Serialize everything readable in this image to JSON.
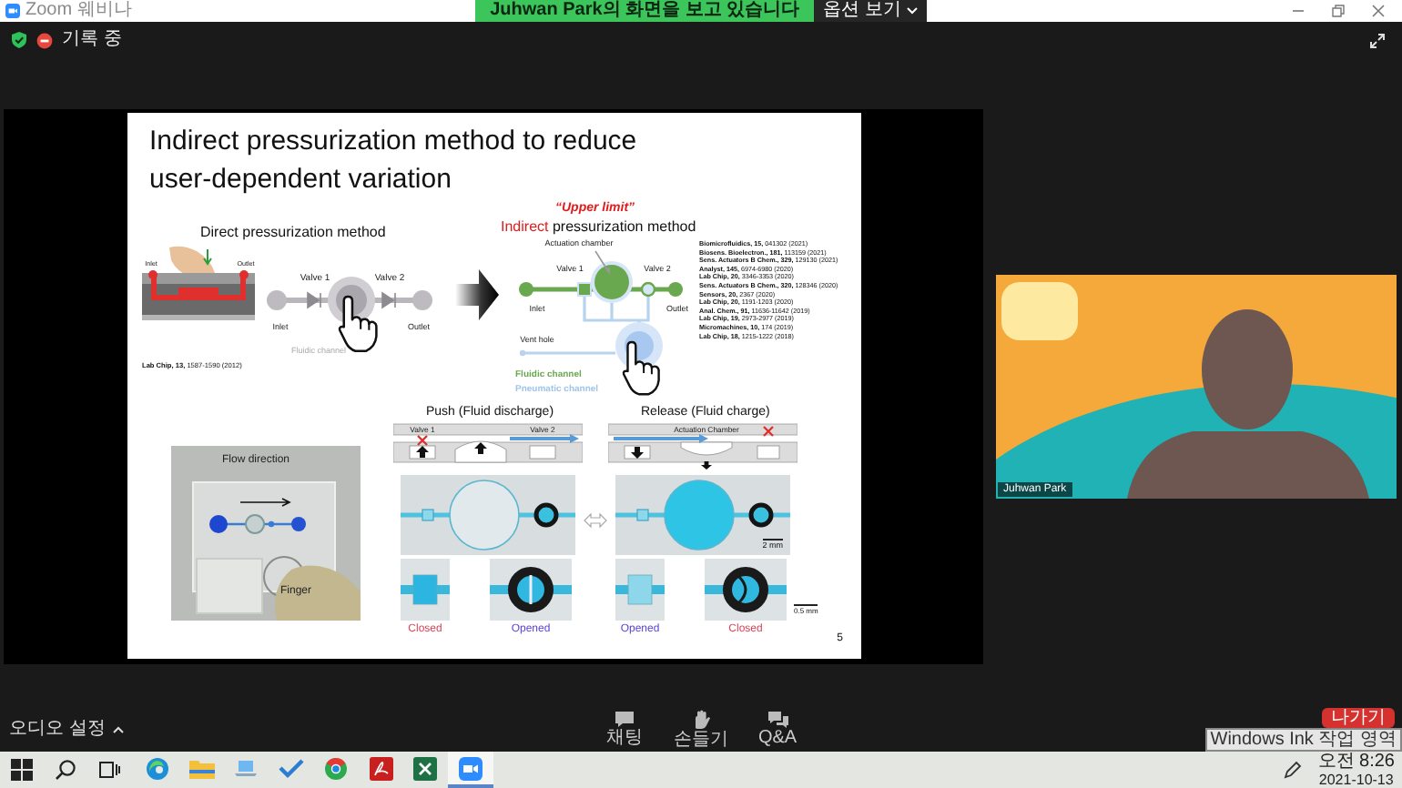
{
  "window": {
    "title": "Zoom 웨비나"
  },
  "share_banner": {
    "text": "Juhwan Park의 화면을 보고 있습니다",
    "options_button": "옵션 보기"
  },
  "status": {
    "recording": true,
    "recording_label": "기록 중"
  },
  "slide": {
    "title": "Indirect pressurization method to reduce user-dependent variation",
    "direct": {
      "heading": "Direct pressurization method",
      "chip_inlet": "Inlet",
      "chip_outlet": "Outlet",
      "valves": [
        "Valve 1",
        "Valve 2"
      ],
      "inlet": "Inlet",
      "outlet": "Outlet",
      "channel_label": "Fluidic channel",
      "citation": "**Lab Chip, 13,** 1587-1590 (2012)"
    },
    "indirect": {
      "note": "“Upper limit”",
      "heading": "**Indirect** pressurization method",
      "chamber_label": "Actuation chamber",
      "valves": [
        "Valve 1",
        "Valve 2"
      ],
      "inlet": "Inlet",
      "outlet": "Outlet",
      "vent_label": "Vent hole",
      "legend": [
        {
          "label": "Fluidic channel",
          "color": "#6aa84f"
        },
        {
          "label": "Pneumatic channel",
          "color": "#9fc5e8"
        }
      ],
      "references": [
        "**Biomicrofluidics, 15,** 041302 (2021)",
        "**Biosens. Bioelectron., 181,** 113159 (2021)",
        "**Sens. Actuators B Chem., 329,** 129130 (2021)",
        "**Analyst, 145,** 6974-6980 (2020)",
        "**Lab Chip, 20,** 3346-3353 (2020)",
        "**Sens. Actuators B Chem., 320,** 128346 (2020)",
        "**Sensors, 20,** 2367 (2020)",
        "**Lab Chip, 20,** 1191-1203 (2020)",
        "**Anal. Chem., 91,** 11636-11642 (2019)",
        "**Lab Chip, 19,** 2973-2977 (2019)",
        "**Micromachines, 10,** 174 (2019)",
        "**Lab Chip, 18,** 1215-1222 (2018)"
      ]
    },
    "photo": {
      "flow_label": "Flow direction",
      "finger_label": "Finger"
    },
    "panels": [
      {
        "kind": "push",
        "heading": "Push (Fluid discharge)",
        "valves": [
          "Valve 1",
          "Valve 2"
        ],
        "chamber_filled": false,
        "valve_images": [
          {
            "label": "Closed",
            "open": false
          },
          {
            "label": "Opened",
            "open": true
          }
        ]
      },
      {
        "kind": "release",
        "heading": "Release (Fluid charge)",
        "chamber_label": "Actuation Chamber",
        "chamber_filled": true,
        "scale_label": "2 mm",
        "valve_images": [
          {
            "label": "Opened",
            "open": true
          },
          {
            "label": "Closed",
            "open": false
          }
        ],
        "small_scale_label": "0.5 mm"
      }
    ],
    "page_number": "5"
  },
  "video": {
    "participant": "Juhwan Park"
  },
  "toolbar": {
    "audio_settings": "오디오 설정",
    "actions": [
      {
        "kind": "chat",
        "label": "채팅"
      },
      {
        "kind": "hand",
        "label": "손들기"
      },
      {
        "kind": "qa",
        "label": "Q&A"
      }
    ],
    "leave_button": "나가기"
  },
  "tooltip": "Windows Ink 작업 영역",
  "taskbar": {
    "buttons": [
      {
        "kind": "start"
      },
      {
        "kind": "search"
      },
      {
        "kind": "taskview"
      }
    ],
    "apps": [
      {
        "kind": "edge",
        "selected": false
      },
      {
        "kind": "explorer",
        "selected": false
      },
      {
        "kind": "laptop",
        "selected": false
      },
      {
        "kind": "todo",
        "selected": false
      },
      {
        "kind": "chrome",
        "selected": false
      },
      {
        "kind": "pdf",
        "selected": false
      },
      {
        "kind": "excel",
        "selected": false
      },
      {
        "kind": "zoom",
        "selected": true
      }
    ],
    "clock": {
      "time": "오전 8:26",
      "date": "2021-10-13"
    }
  }
}
